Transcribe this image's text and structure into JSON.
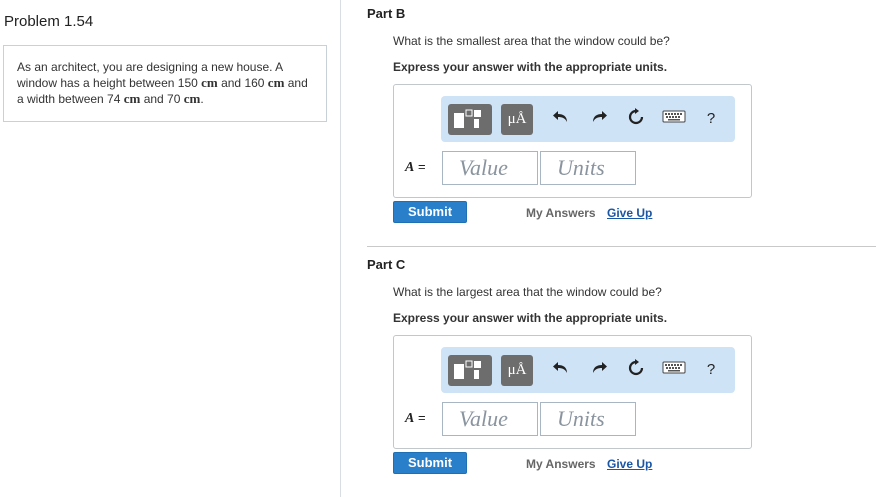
{
  "problem": {
    "title": "Problem 1.54",
    "text_1": "As an architect, you are designing a new house. A window has a height between 150 ",
    "unit_cm": "cm",
    "text_2": " and 160 ",
    "text_3": " and a width between 74 ",
    "text_4": " and 70 ",
    "text_5": "."
  },
  "parts": [
    {
      "label": "Part B",
      "question": "What is the smallest area that the window could be?",
      "instruction": "Express your answer with the appropriate units.",
      "variable": "A",
      "equals": " =",
      "value_placeholder": "Value",
      "units_placeholder": "Units",
      "submit_label": "Submit",
      "my_answers_label": "My Answers",
      "give_up_label": "Give Up"
    },
    {
      "label": "Part C",
      "question": "What is the largest area that the window could be?",
      "instruction": "Express your answer with the appropriate units.",
      "variable": "A",
      "equals": " =",
      "value_placeholder": "Value",
      "units_placeholder": "Units",
      "submit_label": "Submit",
      "my_answers_label": "My Answers",
      "give_up_label": "Give Up"
    }
  ],
  "toolbar": {
    "units_button": "μÅ",
    "help_label": "?",
    "icons": [
      "templates-icon",
      "units-icon",
      "undo-icon",
      "redo-icon",
      "reset-icon",
      "keyboard-icon",
      "help-icon"
    ]
  },
  "colors": {
    "toolbar_bg": "#cfe3f7",
    "submit_bg": "#2a7fcb",
    "link": "#1a56a6"
  }
}
